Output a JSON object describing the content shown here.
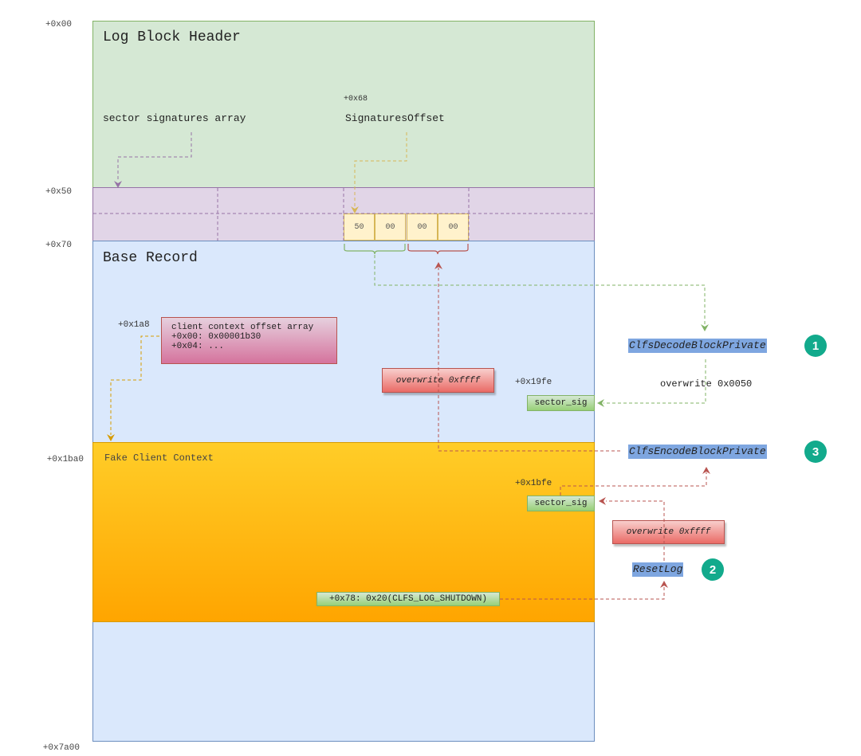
{
  "offsets": {
    "o00": "+0x00",
    "o50": "+0x50",
    "o70": "+0x70",
    "o1ba0": "+0x1ba0",
    "o7a00": "+0x7a00"
  },
  "regions": {
    "log_block_header": {
      "title": "Log Block Header",
      "color": "#d5e8d4"
    },
    "sector_signatures_area": {
      "color": "#e1d5e7"
    },
    "base_record": {
      "title": "Base Record",
      "color": "#dae8fc"
    },
    "fake_client_context": {
      "title": "Fake Client Context",
      "color": "#ffb000"
    }
  },
  "header_labels": {
    "sector_signatures_array": "sector signatures array",
    "signatures_offset_offset": "+0x68",
    "signatures_offset": "SignaturesOffset"
  },
  "signature_bytes": [
    "50",
    "00",
    "00",
    "00"
  ],
  "client_context_array": {
    "offset": "+0x1a8",
    "lines": [
      "client context offset array",
      "+0x00: 0x00001b30",
      "+0x04: ..."
    ]
  },
  "base_record_items": {
    "overwrite_label": "overwrite 0xffff",
    "sector_sig_offset": "+0x19fe",
    "sector_sig": "sector_sig"
  },
  "fake_context_items": {
    "sector_sig_offset": "+0x1bfe",
    "sector_sig": "sector_sig",
    "shutdown_field": "+0x78: 0x20(CLFS_LOG_SHUTDOWN)"
  },
  "functions": [
    {
      "name": "ClfsDecodeBlockPrivate",
      "step": "1",
      "note": "overwrite 0x0050"
    },
    {
      "name": "ResetLog",
      "step": "2",
      "note": "overwrite 0xffff"
    },
    {
      "name": "ClfsEncodeBlockPrivate",
      "step": "3"
    }
  ],
  "colors": {
    "green_arrow": "#82b366",
    "red_arrow": "#b85450",
    "orange_arrow": "#d79b00",
    "purple_arrow": "#9673a6",
    "yellow_arrow": "#d6b656",
    "badge": "#12aa8c",
    "function_highlight": "#7ea6e0"
  }
}
